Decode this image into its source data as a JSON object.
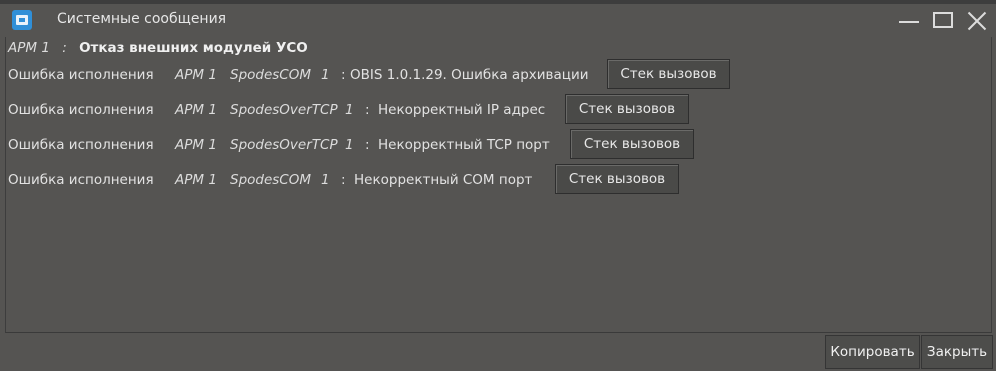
{
  "window": {
    "title": "Системные сообщения"
  },
  "header": {
    "arm": "АРМ 1",
    "separator": ":",
    "message": "Отказ внешних модулей УСО"
  },
  "messages": [
    {
      "type": "Ошибка исполнения",
      "arm": "АРМ 1",
      "module": "SpodesCOM",
      "num": "1",
      "separator": ":",
      "text": "OBIS 1.0.1.29.  Ошибка архивации",
      "button": "Стек вызовов"
    },
    {
      "type": "Ошибка исполнения",
      "arm": "АРМ 1",
      "module": "SpodesOverTCP",
      "num": "1",
      "separator": ":",
      "text": "Некорректный IP адрес",
      "button": "Стек вызовов"
    },
    {
      "type": "Ошибка исполнения",
      "arm": "АРМ 1",
      "module": "SpodesOverTCP",
      "num": "1",
      "separator": ":",
      "text": "Некорректный TCP порт",
      "button": "Стек вызовов"
    },
    {
      "type": "Ошибка исполнения",
      "arm": "АРМ 1",
      "module": "SpodesCOM",
      "num": "1",
      "separator": ":",
      "text": "Некорректный COM порт",
      "button": "Стек вызовов"
    }
  ],
  "footer": {
    "copy_label": "Копировать",
    "close_label": "Закрыть"
  },
  "icons": {
    "app": "app-icon",
    "minimize": "minimize-icon",
    "maximize": "maximize-icon",
    "close": "close-icon"
  }
}
